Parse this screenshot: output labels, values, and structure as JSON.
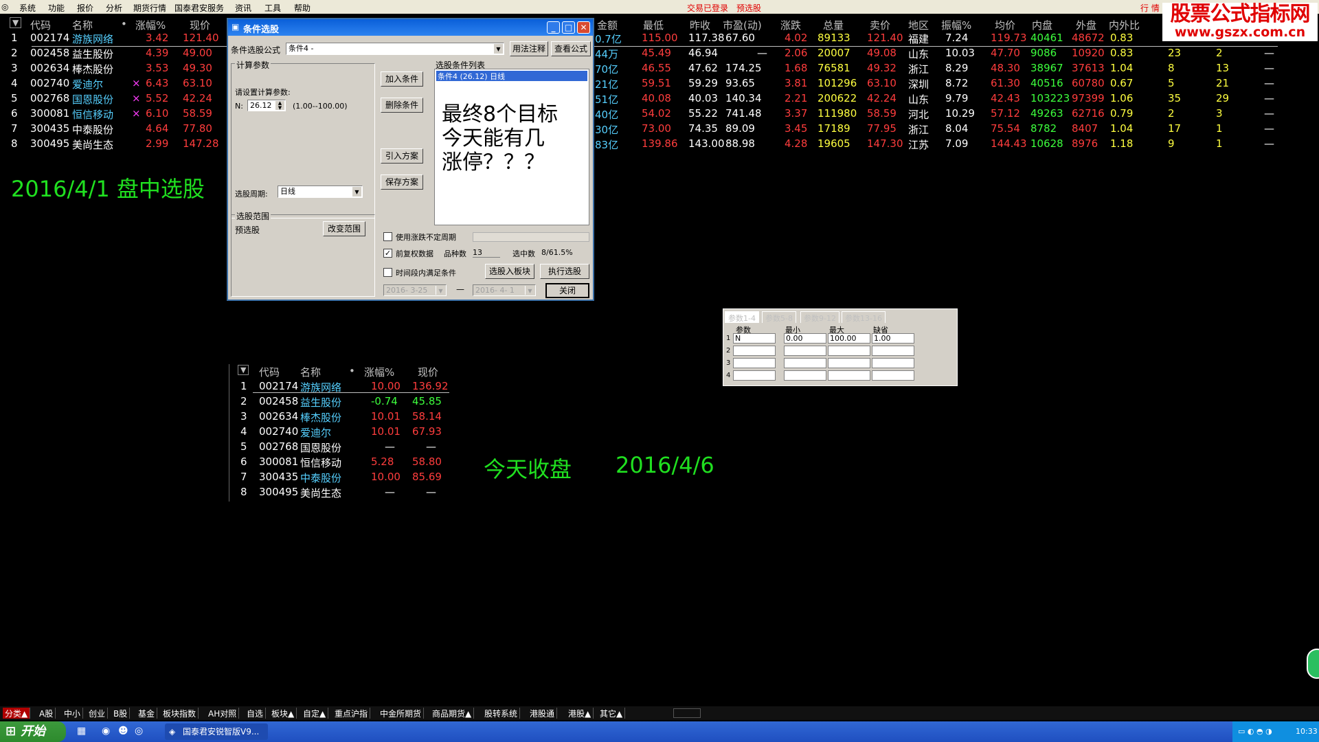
{
  "menubar": {
    "items": [
      "系统",
      "功能",
      "报价",
      "分析",
      "期货行情",
      "国泰君安服务",
      "资讯",
      "工具",
      "帮助"
    ],
    "status_login": "交易已登录",
    "status_warn": "预选股",
    "right_tab": "行 情"
  },
  "watermark": {
    "line1": "股票公式指标网",
    "line2": "www.gszx.com.cn"
  },
  "quote_table": {
    "headers_left": [
      "代码",
      "名称",
      "•",
      "涨幅%",
      "现价"
    ],
    "headers_right": [
      "金额",
      "最低",
      "昨收",
      "市盈(动)",
      "涨跌",
      "总量",
      "卖价",
      "地区",
      "振幅%",
      "均价",
      "内盘",
      "外盘",
      "内外比"
    ],
    "rows": [
      {
        "n": "1",
        "code": "002174",
        "name": "游族网络",
        "mark": "",
        "pct": "3.42",
        "price": "121.40",
        "amt": "0.7亿",
        "low": "115.00",
        "prev": "117.38",
        "pe": "67.60",
        "chg": "4.02",
        "vol": "89133",
        "ask": "121.40",
        "region": "福建",
        "amp": "7.24",
        "avg": "119.73",
        "inner": "40461",
        "outer": "48672",
        "ratio": "0.83",
        "x1": "",
        "x2": ""
      },
      {
        "n": "2",
        "code": "002458",
        "name": "益生股份",
        "mark": "",
        "pct": "4.39",
        "price": "49.00",
        "amt": "44万",
        "low": "45.49",
        "prev": "46.94",
        "pe": "—",
        "chg": "2.06",
        "vol": "20007",
        "ask": "49.08",
        "region": "山东",
        "amp": "10.03",
        "avg": "47.70",
        "inner": "9086",
        "outer": "10920",
        "ratio": "0.83",
        "x1": "23",
        "x2": "2"
      },
      {
        "n": "3",
        "code": "002634",
        "name": "棒杰股份",
        "mark": "",
        "pct": "3.53",
        "price": "49.30",
        "amt": "70亿",
        "low": "46.55",
        "prev": "47.62",
        "pe": "174.25",
        "chg": "1.68",
        "vol": "76581",
        "ask": "49.32",
        "region": "浙江",
        "amp": "8.29",
        "avg": "48.30",
        "inner": "38967",
        "outer": "37613",
        "ratio": "1.04",
        "x1": "8",
        "x2": "13"
      },
      {
        "n": "4",
        "code": "002740",
        "name": "爱迪尔",
        "mark": "×",
        "pct": "6.43",
        "price": "63.10",
        "amt": "21亿",
        "low": "59.51",
        "prev": "59.29",
        "pe": "93.65",
        "chg": "3.81",
        "vol": "101296",
        "ask": "63.10",
        "region": "深圳",
        "amp": "8.72",
        "avg": "61.30",
        "inner": "40516",
        "outer": "60780",
        "ratio": "0.67",
        "x1": "5",
        "x2": "21"
      },
      {
        "n": "5",
        "code": "002768",
        "name": "国恩股份",
        "mark": "×",
        "pct": "5.52",
        "price": "42.24",
        "amt": "51亿",
        "low": "40.08",
        "prev": "40.03",
        "pe": "140.34",
        "chg": "2.21",
        "vol": "200622",
        "ask": "42.24",
        "region": "山东",
        "amp": "9.79",
        "avg": "42.43",
        "inner": "103223",
        "outer": "97399",
        "ratio": "1.06",
        "x1": "35",
        "x2": "29"
      },
      {
        "n": "6",
        "code": "300081",
        "name": "恒信移动",
        "mark": "×",
        "pct": "6.10",
        "price": "58.59",
        "amt": "40亿",
        "low": "54.02",
        "prev": "55.22",
        "pe": "741.48",
        "chg": "3.37",
        "vol": "111980",
        "ask": "58.59",
        "region": "河北",
        "amp": "10.29",
        "avg": "57.12",
        "inner": "49263",
        "outer": "62716",
        "ratio": "0.79",
        "x1": "2",
        "x2": "3"
      },
      {
        "n": "7",
        "code": "300435",
        "name": "中泰股份",
        "mark": "",
        "pct": "4.64",
        "price": "77.80",
        "amt": "30亿",
        "low": "73.00",
        "prev": "74.35",
        "pe": "89.09",
        "chg": "3.45",
        "vol": "17189",
        "ask": "77.95",
        "region": "浙江",
        "amp": "8.04",
        "avg": "75.54",
        "inner": "8782",
        "outer": "8407",
        "ratio": "1.04",
        "x1": "17",
        "x2": "1"
      },
      {
        "n": "8",
        "code": "300495",
        "name": "美尚生态",
        "mark": "",
        "pct": "2.99",
        "price": "147.28",
        "amt": "83亿",
        "low": "139.86",
        "prev": "143.00",
        "pe": "88.98",
        "chg": "4.28",
        "vol": "19605",
        "ask": "147.30",
        "region": "江苏",
        "amp": "7.09",
        "avg": "144.43",
        "inner": "10628",
        "outer": "8976",
        "ratio": "1.18",
        "x1": "9",
        "x2": "1"
      }
    ],
    "dash": "—"
  },
  "annot": {
    "left": "2016/4/1  盘中选股",
    "close_label": "今天收盘",
    "close_date": "2016/4/6"
  },
  "dialog": {
    "title": "条件选股",
    "formula_label": "条件选股公式",
    "formula_value": "条件4        -",
    "btn_usage": "用法注释",
    "btn_view": "查看公式",
    "calc_group": "计算参数",
    "calc_prompt": "请设置计算参数:",
    "param_name": "N:",
    "param_value": "26.12",
    "param_range": "(1.00--100.00)",
    "btn_add": "加入条件",
    "btn_delete": "删除条件",
    "btn_import": "引入方案",
    "btn_save": "保存方案",
    "list_label": "选股条件列表",
    "list_item": "条件4 (26.12) 日线",
    "overlay_text": [
      "最终8个目标",
      "今天能有几",
      "涨停？？？"
    ],
    "period_label": "选股周期:",
    "period_value": "日线",
    "scope_group": "选股范围",
    "scope_value": "预选股",
    "btn_scope": "改变范围",
    "chk_unfixed": "使用涨跌不定周期",
    "chk_rights": "前复权数据",
    "count_label": "品种数",
    "count_value": "13",
    "selected_label": "选中数",
    "selected_value": "8/61.5%",
    "chk_period": "时间段内满足条件",
    "btn_to_block": "选股入板块",
    "btn_run": "执行选股",
    "date_from": "2016- 3-25",
    "date_to": "2016- 4- 1",
    "tilde": "—",
    "btn_close": "关闭"
  },
  "params_panel": {
    "tabs": [
      "参数1-4",
      "参数5-8",
      "参数9-12",
      "参数13-16"
    ],
    "cols": [
      "参数",
      "最小",
      "最大",
      "缺省"
    ],
    "rows": [
      {
        "n": "1",
        "name": "N",
        "min": "0.00",
        "max": "100.00",
        "def": "1.00"
      },
      {
        "n": "2",
        "name": "",
        "min": "",
        "max": "",
        "def": ""
      },
      {
        "n": "3",
        "name": "",
        "min": "",
        "max": "",
        "def": ""
      },
      {
        "n": "4",
        "name": "",
        "min": "",
        "max": "",
        "def": ""
      }
    ]
  },
  "close_table": {
    "headers": [
      "代码",
      "名称",
      "•",
      "涨幅%",
      "现价"
    ],
    "rows": [
      {
        "n": "1",
        "code": "002174",
        "name": "游族网络",
        "pct": "10.00",
        "price": "136.92"
      },
      {
        "n": "2",
        "code": "002458",
        "name": "益生股份",
        "pct": "-0.74",
        "price": "45.85"
      },
      {
        "n": "3",
        "code": "002634",
        "name": "棒杰股份",
        "pct": "10.01",
        "price": "58.14"
      },
      {
        "n": "4",
        "code": "002740",
        "name": "爱迪尔",
        "pct": "10.01",
        "price": "67.93"
      },
      {
        "n": "5",
        "code": "002768",
        "name": "国恩股份",
        "pct": "—",
        "price": "—"
      },
      {
        "n": "6",
        "code": "300081",
        "name": "恒信移动",
        "pct": "5.28",
        "price": "58.80"
      },
      {
        "n": "7",
        "code": "300435",
        "name": "中泰股份",
        "pct": "10.00",
        "price": "85.69"
      },
      {
        "n": "8",
        "code": "300495",
        "name": "美尚生态",
        "pct": "—",
        "price": "—"
      }
    ]
  },
  "bottom_tabs": [
    "分类▲",
    "A股",
    "中小",
    "创业",
    "B股",
    "基金",
    "板块指数",
    "AH对照",
    "自选",
    "板块▲",
    "自定▲",
    "重点沪指",
    "中金所期货",
    "商品期货▲",
    "股转系统",
    "港股通",
    "港股▲",
    "其它▲"
  ],
  "taskbar": {
    "start": "开始",
    "window": "国泰君安锐智版V9...",
    "time": "10:33"
  },
  "colors": {
    "up": "#ff3d3d",
    "down": "#3dff3d",
    "annot": "#20e020",
    "title_bar": "#0a5fd8",
    "dialog_bg": "#d4d0c8",
    "selected": "#3168d5"
  }
}
